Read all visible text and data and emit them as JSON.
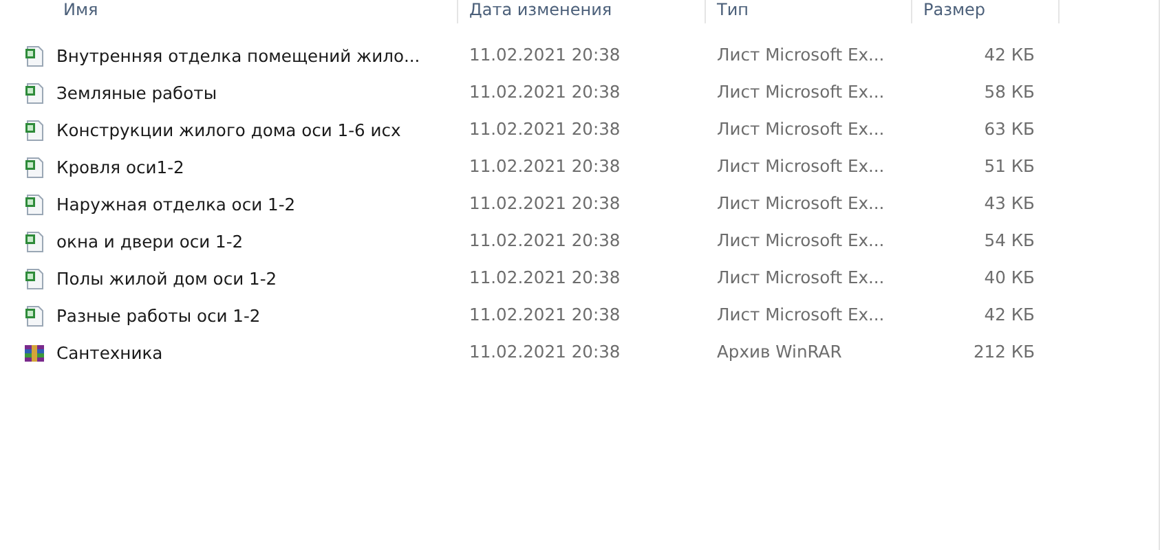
{
  "columns": [
    "Имя",
    "Дата изменения",
    "Тип",
    "Размер"
  ],
  "files": [
    {
      "kind": "excel",
      "name": "Внутренняя отделка помещений жило...",
      "date": "11.02.2021 20:38",
      "type": "Лист Microsoft Ex...",
      "size": "42 КБ"
    },
    {
      "kind": "excel",
      "name": "Земляные работы",
      "date": "11.02.2021 20:38",
      "type": "Лист Microsoft Ex...",
      "size": "58 КБ"
    },
    {
      "kind": "excel",
      "name": "Конструкции жилого дома оси 1-6 исх",
      "date": "11.02.2021 20:38",
      "type": "Лист Microsoft Ex...",
      "size": "63 КБ"
    },
    {
      "kind": "excel",
      "name": "Кровля оси1-2",
      "date": "11.02.2021 20:38",
      "type": "Лист Microsoft Ex...",
      "size": "51 КБ"
    },
    {
      "kind": "excel",
      "name": "Наружная отделка оси 1-2",
      "date": "11.02.2021 20:38",
      "type": "Лист Microsoft Ex...",
      "size": "43 КБ"
    },
    {
      "kind": "excel",
      "name": "окна и двери оси 1-2",
      "date": "11.02.2021 20:38",
      "type": "Лист Microsoft Ex...",
      "size": "54 КБ"
    },
    {
      "kind": "excel",
      "name": "Полы жилой дом оси 1-2",
      "date": "11.02.2021 20:38",
      "type": "Лист Microsoft Ex...",
      "size": "40 КБ"
    },
    {
      "kind": "excel",
      "name": "Разные работы оси 1-2",
      "date": "11.02.2021 20:38",
      "type": "Лист Microsoft Ex...",
      "size": "42 КБ"
    },
    {
      "kind": "winrar",
      "name": "Сантехника",
      "date": "11.02.2021 20:38",
      "type": "Архив WinRAR",
      "size": "212 КБ"
    }
  ]
}
